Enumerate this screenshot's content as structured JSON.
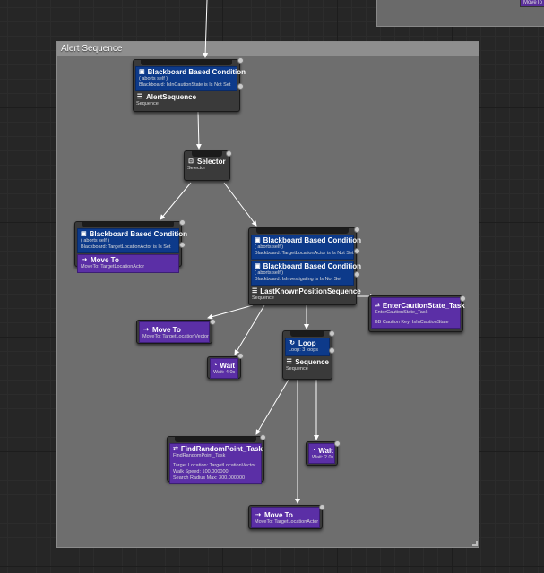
{
  "comment": {
    "title": "Alert Sequence"
  },
  "offscreen": {
    "label": "MoveTo"
  },
  "nodes": {
    "root": {
      "decorator": {
        "title": "Blackboard Based Condition",
        "sub1": "( aborts self )",
        "sub2": "Blackboard: IsInCautionState is Is Not Set"
      },
      "title": "AlertSequence",
      "sub": "Sequence"
    },
    "selector": {
      "title": "Selector",
      "sub": "Selector"
    },
    "left": {
      "decorator": {
        "title": "Blackboard Based Condition",
        "sub1": "( aborts self )",
        "sub2": "Blackboard: TargetLocationActor is Is Set"
      },
      "task_title": "Move To",
      "task_sub": "MoveTo: TargetLocationActor"
    },
    "right": {
      "decorator1": {
        "title": "Blackboard Based Condition",
        "sub1": "( aborts self )",
        "sub2": "Blackboard: TargetLocationActor is Is Not Set"
      },
      "decorator2": {
        "title": "Blackboard Based Condition",
        "sub1": "( aborts self )",
        "sub2": "Blackboard: IsInvestigating is Is Not Set"
      },
      "title": "LastKnownPositionSequence",
      "sub": "Sequence"
    },
    "caution": {
      "title": "EnterCautionState_Task",
      "sub1": "EnterCautionState_Task",
      "sub2": "BB Caution Key: IsInCautionState"
    },
    "moveto_vec": {
      "title": "Move To",
      "sub": "MoveTo: TargetLocationVector"
    },
    "wait4": {
      "title": "Wait",
      "sub": "Wait: 4.0s"
    },
    "loop": {
      "title": "Loop",
      "sub": "Loop: 3 loops",
      "seq_title": "Sequence",
      "seq_sub": "Sequence"
    },
    "findrandom": {
      "title": "FindRandomPoint_Task",
      "sub1": "FindRandomPoint_Task",
      "sub2": "Target Location: TargetLocationVector",
      "sub3": "Walk Speed: 100.000000",
      "sub4": "Search Radius Max: 300.000000"
    },
    "wait2": {
      "title": "Wait",
      "sub": "Wait: 2.0s"
    },
    "moveto_actor": {
      "title": "Move To",
      "sub": "MoveTo: TargetLocationActor"
    }
  },
  "colors": {
    "decorator": "#0d3a8a",
    "task": "#5b2fa6",
    "wire": "#ffffff",
    "comment_bg": "#6e6e6e"
  },
  "icons": {
    "decorator": "blackboard-icon",
    "composite_sequence": "sequence-icon",
    "composite_selector": "selector-icon",
    "task_move": "move-to-icon",
    "task_wait": "wait-icon",
    "task_blueprint": "blueprint-task-icon",
    "loop": "loop-icon"
  }
}
